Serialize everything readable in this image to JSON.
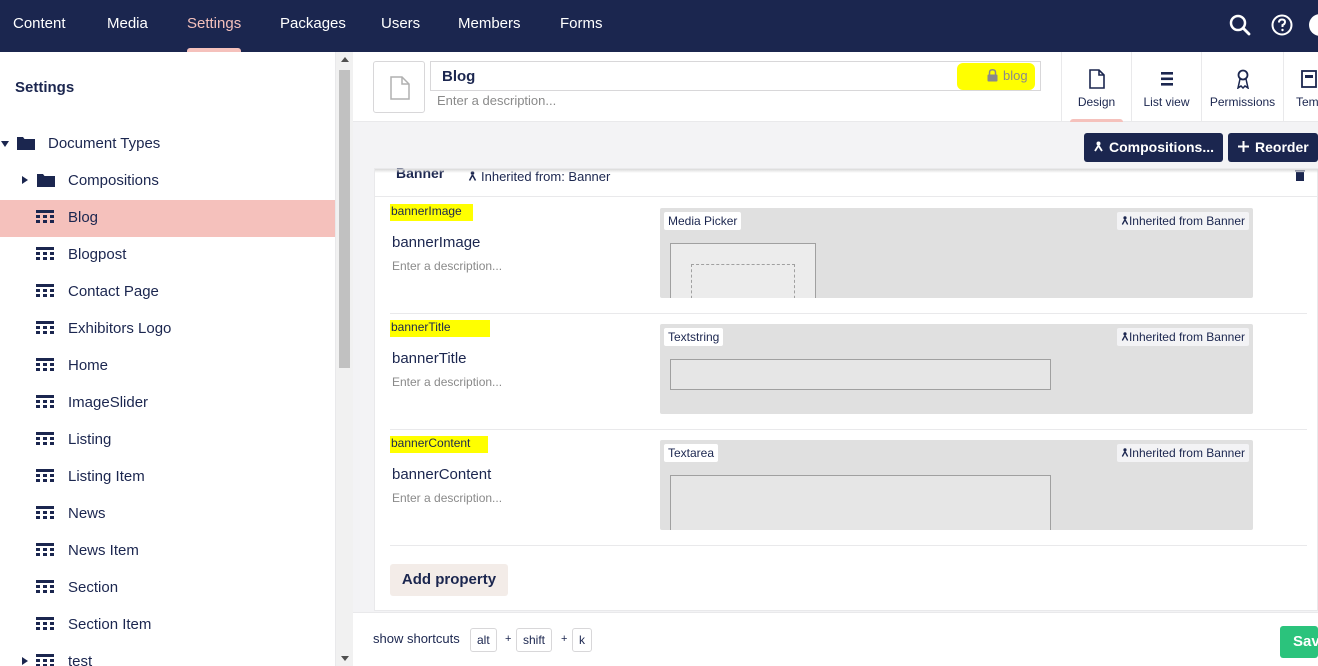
{
  "nav": {
    "items": [
      "Content",
      "Media",
      "Settings",
      "Packages",
      "Users",
      "Members",
      "Forms"
    ],
    "active": "Settings"
  },
  "sidebar": {
    "title": "Settings",
    "root": "Document Types",
    "items": [
      "Compositions",
      "Blog",
      "Blogpost",
      "Contact Page",
      "Exhibitors Logo",
      "Home",
      "ImageSlider",
      "Listing",
      "Listing Item",
      "News",
      "News Item",
      "Section",
      "Section Item",
      "test"
    ],
    "selected": "Blog"
  },
  "header": {
    "name": "Blog",
    "alias": "blog",
    "description_placeholder": "Enter a description..."
  },
  "tabs": [
    "Design",
    "List view",
    "Permissions",
    "Templ"
  ],
  "toolbar": {
    "compositions_label": "Compositions...",
    "reorder_label": "Reorder"
  },
  "group": {
    "title": "Banner",
    "inherited": "Inherited from: Banner"
  },
  "properties": [
    {
      "alias": "bannerImage",
      "name": "bannerImage",
      "description": "Enter a description...",
      "editor": "Media Picker",
      "inherited": "Inherited from Banner"
    },
    {
      "alias": "bannerTitle",
      "name": "bannerTitle",
      "description": "Enter a description...",
      "editor": "Textstring",
      "inherited": "Inherited from Banner"
    },
    {
      "alias": "bannerContent",
      "name": "bannerContent",
      "description": "Enter a description...",
      "editor": "Textarea",
      "inherited": "Inherited from Banner"
    }
  ],
  "add_property_label": "Add property",
  "footer": {
    "shortcuts_label": "show shortcuts",
    "keys": [
      "alt",
      "shift",
      "k"
    ],
    "plus": "+",
    "save_label": "Save"
  },
  "colors": {
    "nav_bg": "#1b264f",
    "accent": "#f5c1bc",
    "highlight": "#ffff00",
    "save": "#2bc37c"
  }
}
